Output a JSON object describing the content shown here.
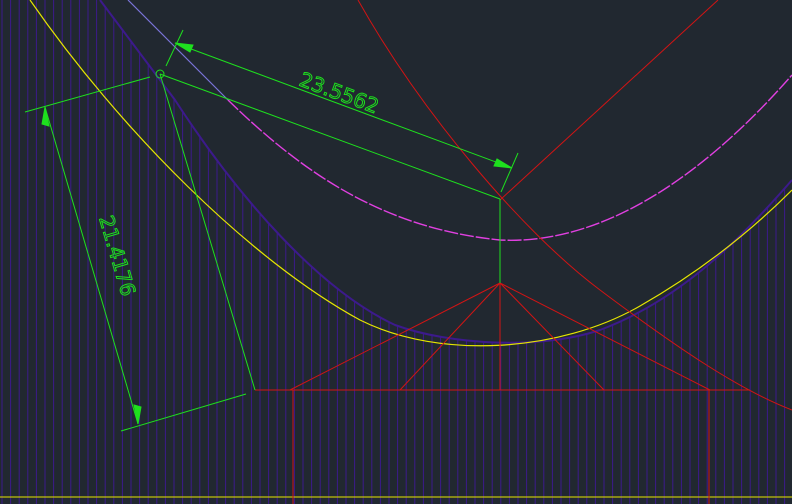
{
  "colors": {
    "background": "#212830",
    "hatch": "#3c1a8c",
    "dimension": "#1ee01e",
    "construction": "#d21414",
    "arc_yellow": "#e6e600",
    "arc_magenta": "#e040e0",
    "arc_blue": "#7a74d8"
  },
  "dimensions": {
    "aligned_top": "23.5562",
    "aligned_left": "21.4176"
  }
}
